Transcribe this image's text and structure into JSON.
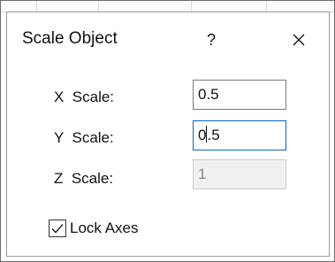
{
  "dialog": {
    "title": "Scale Object",
    "help_label": "?",
    "close_icon": "close-icon"
  },
  "fields": {
    "x": {
      "label": "X  Scale:",
      "value": "0.5",
      "state": "enabled"
    },
    "y": {
      "label": "Y  Scale:",
      "value_before_caret": "0",
      "value_after_caret": ".5",
      "state": "focused"
    },
    "z": {
      "label": "Z  Scale:",
      "value": "1",
      "state": "disabled"
    }
  },
  "lock_axes": {
    "label": "Lock Axes",
    "checked": true,
    "icon": "checkmark-icon"
  },
  "colors": {
    "focus_border": "#0a64c8",
    "disabled_text": "#8a8a8a",
    "disabled_bg": "#f0f0f0"
  }
}
